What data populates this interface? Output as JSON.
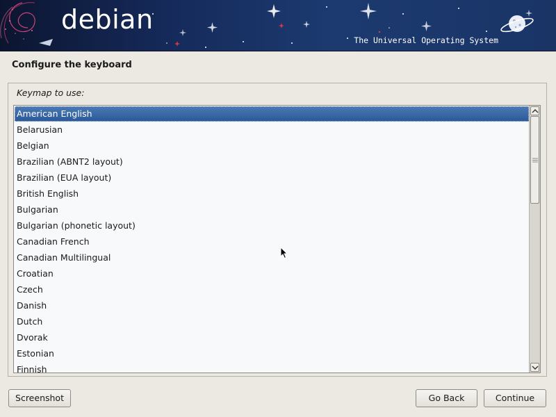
{
  "banner": {
    "logo_text": "debian",
    "tagline": "The Universal Operating System"
  },
  "page": {
    "title": "Configure the keyboard",
    "field_label": "Keymap to use:"
  },
  "keymaps": [
    "American English",
    "Belarusian",
    "Belgian",
    "Brazilian (ABNT2 layout)",
    "Brazilian (EUA layout)",
    "British English",
    "Bulgarian",
    "Bulgarian (phonetic layout)",
    "Canadian French",
    "Canadian Multilingual",
    "Croatian",
    "Czech",
    "Danish",
    "Dutch",
    "Dvorak",
    "Estonian",
    "Finnish"
  ],
  "selected_keymap": "American English",
  "buttons": {
    "screenshot": "Screenshot",
    "go_back": "Go Back",
    "continue": "Continue"
  },
  "colors": {
    "selection": "#3b68a8",
    "banner": "#1c3a70",
    "background": "#ece9e3"
  }
}
